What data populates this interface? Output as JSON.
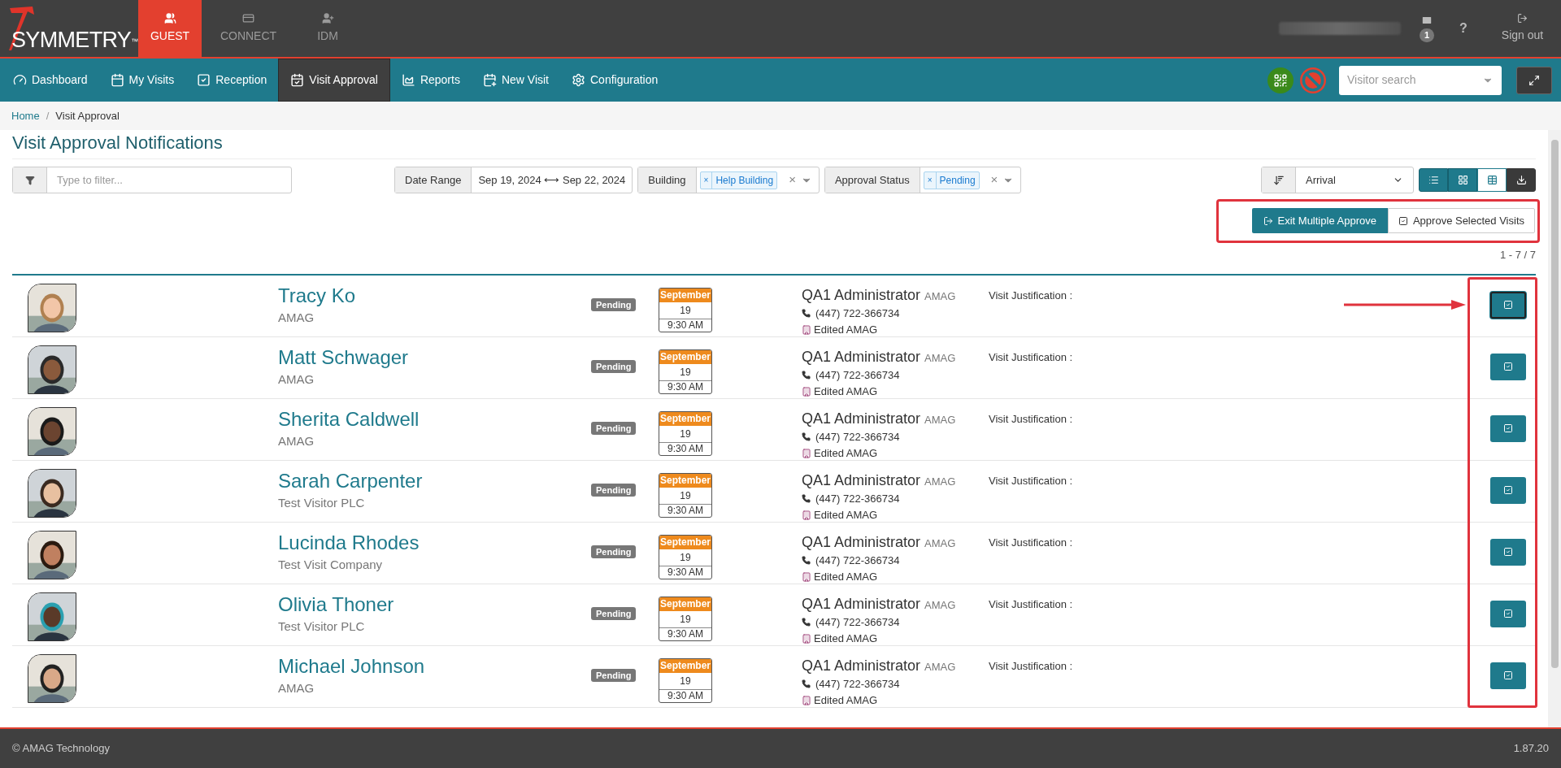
{
  "brand": "SYMMETRY",
  "brand_mark": "™",
  "modules": [
    {
      "kind": "guest",
      "label": "GUEST",
      "selected": true
    },
    {
      "kind": "connect",
      "label": "CONNECT",
      "selected": false
    },
    {
      "kind": "idm",
      "label": "IDM",
      "selected": false
    }
  ],
  "user_area": {
    "mail_count": "1",
    "help": "?",
    "sign_out": "Sign out"
  },
  "nav": [
    {
      "kind": "dashboard",
      "label": "Dashboard",
      "selected": false
    },
    {
      "kind": "my_visits",
      "label": "My Visits",
      "selected": false
    },
    {
      "kind": "reception",
      "label": "Reception",
      "selected": false
    },
    {
      "kind": "visit_approval",
      "label": "Visit Approval",
      "selected": true
    },
    {
      "kind": "reports",
      "label": "Reports",
      "selected": false
    },
    {
      "kind": "new_visit",
      "label": "New Visit",
      "selected": false
    },
    {
      "kind": "configuration",
      "label": "Configuration",
      "selected": false
    }
  ],
  "visitor_search": {
    "placeholder": "Visitor search"
  },
  "breadcrumb": [
    "Home",
    "Visit Approval"
  ],
  "breadcrumb_separator": "/",
  "page_title": "Visit Approval Notifications",
  "filter": {
    "placeholder": "Type to filter..."
  },
  "date_range": {
    "label": "Date Range",
    "value": "Sep 19, 2024 ⟷ Sep 22, 2024"
  },
  "selects": [
    {
      "label": "Building",
      "tags": [
        "Help Building"
      ],
      "remove": "×",
      "clear": "×"
    },
    {
      "label": "Approval Status",
      "tags": [
        "Pending"
      ],
      "remove": "×",
      "clear": "×"
    }
  ],
  "sort": {
    "value": "Arrival"
  },
  "view_buttons": [
    {
      "kind": "list",
      "selected": true
    },
    {
      "kind": "grid",
      "selected": true
    },
    {
      "kind": "table",
      "selected": false
    },
    {
      "kind": "download",
      "selected": false
    }
  ],
  "actions": {
    "exit": "Exit Multiple Approve",
    "approve": "Approve Selected Visits"
  },
  "pagination": "1 - 7 / 7",
  "rows": [
    {
      "name": "Tracy Ko",
      "company": "AMAG",
      "status": "Pending",
      "month": "September",
      "day": "19",
      "time": "9:30 AM",
      "host": "QA1 Administrator",
      "host_company": "AMAG",
      "phone": "(447) 722-366734",
      "location": "Edited AMAG",
      "justification": "Visit Justification :",
      "focused": true
    },
    {
      "name": "Matt Schwager",
      "company": "AMAG",
      "status": "Pending",
      "month": "September",
      "day": "19",
      "time": "9:30 AM",
      "host": "QA1 Administrator",
      "host_company": "AMAG",
      "phone": "(447) 722-366734",
      "location": "Edited AMAG",
      "justification": "Visit Justification :",
      "focused": false
    },
    {
      "name": "Sherita Caldwell",
      "company": "AMAG",
      "status": "Pending",
      "month": "September",
      "day": "19",
      "time": "9:30 AM",
      "host": "QA1 Administrator",
      "host_company": "AMAG",
      "phone": "(447) 722-366734",
      "location": "Edited AMAG",
      "justification": "Visit Justification :",
      "focused": false
    },
    {
      "name": "Sarah Carpenter",
      "company": "Test Visitor PLC",
      "status": "Pending",
      "month": "September",
      "day": "19",
      "time": "9:30 AM",
      "host": "QA1 Administrator",
      "host_company": "AMAG",
      "phone": "(447) 722-366734",
      "location": "Edited AMAG",
      "justification": "Visit Justification :",
      "focused": false
    },
    {
      "name": "Lucinda Rhodes",
      "company": "Test Visit Company",
      "status": "Pending",
      "month": "September",
      "day": "19",
      "time": "9:30 AM",
      "host": "QA1 Administrator",
      "host_company": "AMAG",
      "phone": "(447) 722-366734",
      "location": "Edited AMAG",
      "justification": "Visit Justification :",
      "focused": false
    },
    {
      "name": "Olivia Thoner",
      "company": "Test Visitor PLC",
      "status": "Pending",
      "month": "September",
      "day": "19",
      "time": "9:30 AM",
      "host": "QA1 Administrator",
      "host_company": "AMAG",
      "phone": "(447) 722-366734",
      "location": "Edited AMAG",
      "justification": "Visit Justification :",
      "focused": false
    },
    {
      "name": "Michael Johnson",
      "company": "AMAG",
      "status": "Pending",
      "month": "September",
      "day": "19",
      "time": "9:30 AM",
      "host": "QA1 Administrator",
      "host_company": "AMAG",
      "phone": "(447) 722-366734",
      "location": "Edited AMAG",
      "justification": "Visit Justification :",
      "focused": false
    }
  ],
  "footer": {
    "copyright": "© AMAG Technology",
    "version": "1.87.20"
  }
}
